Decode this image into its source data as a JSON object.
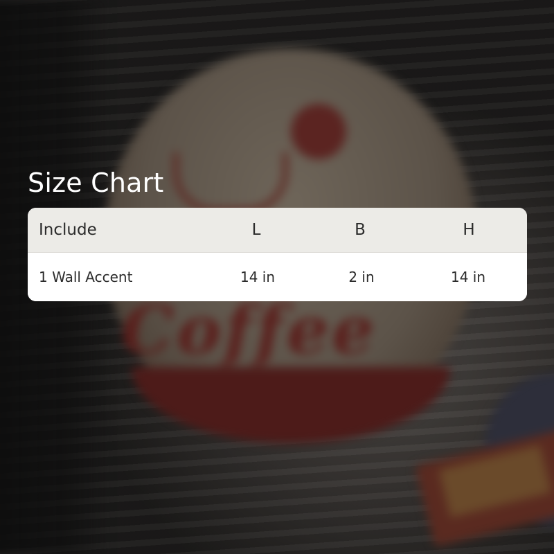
{
  "title": "Size Chart",
  "background": {
    "description_icon": "coffee-bottle-cap-photo",
    "cap_text": "Coffee"
  },
  "table": {
    "headers": [
      "Include",
      "L",
      "B",
      "H"
    ],
    "rows": [
      [
        "1 Wall Accent",
        "14 in",
        "2 in",
        "14 in"
      ]
    ]
  },
  "colors": {
    "header_bg": "#ecebe7",
    "body_bg": "#ffffff",
    "text": "#2b2b2b",
    "title": "#ffffff"
  }
}
